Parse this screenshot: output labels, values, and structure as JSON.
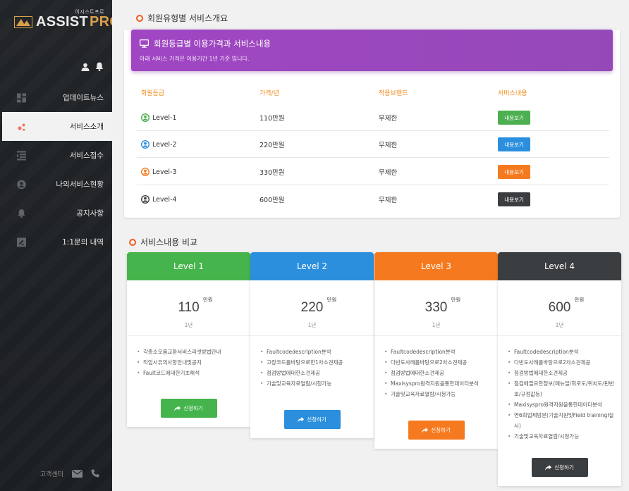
{
  "brand": {
    "small": "어시스트프로",
    "name": "ASSIST",
    "suffix": "PRO"
  },
  "sidebar": {
    "items": [
      {
        "label": "업데이트뉴스",
        "icon": "dashboard-icon"
      },
      {
        "label": "서비스소개",
        "icon": "molecule-icon",
        "active": true
      },
      {
        "label": "서비스접수",
        "icon": "list-icon"
      },
      {
        "label": "나의서비스현황",
        "icon": "user-circle-icon"
      },
      {
        "label": "공지사항",
        "icon": "bell-icon"
      },
      {
        "label": "1:1문의 내역",
        "icon": "message-icon"
      }
    ],
    "footer_label": "고객센터"
  },
  "overview": {
    "section_title": "회원유형별 서비스개요",
    "banner_title": "회원등급별 이용가격과 서비스내용",
    "banner_subtitle": "아래 서비스 가격은 이용기간 1년 기준 입니다.",
    "headers": [
      "회원등급",
      "가격/년",
      "적용브랜드",
      "서비스내용"
    ],
    "rows": [
      {
        "level": "Level-1",
        "price": "110만원",
        "brand": "무제한",
        "button": "내용보기",
        "color": "#4caf50"
      },
      {
        "level": "Level-2",
        "price": "220만원",
        "brand": "무제한",
        "button": "내용보기",
        "color": "#2b8fdd"
      },
      {
        "level": "Level-3",
        "price": "330만원",
        "brand": "무제한",
        "button": "내용보기",
        "color": "#f57a1f"
      },
      {
        "level": "Level-4",
        "price": "600만원",
        "brand": "무제한",
        "button": "내용보기",
        "color": "#3b3e41"
      }
    ]
  },
  "comparison": {
    "section_title": "서비스내용 비교",
    "plans": [
      {
        "name": "Level 1",
        "price": "110",
        "unit": "만원",
        "period": "1년",
        "color": "#45b44c",
        "button": "신청하기",
        "features": [
          "각종소모품교환서비스리셋방법안내",
          "작업시유의사항안내및공지",
          "Fault코드에대한기초해석"
        ]
      },
      {
        "name": "Level 2",
        "price": "220",
        "unit": "만원",
        "period": "1년",
        "color": "#2b8fdd",
        "button": "신청하기",
        "features": [
          "Faultcodedescription분석",
          "고장코드를바탕으로한1차소견제공",
          "점검방법에대한소견제공",
          "기술및교육자료열람/시청가능"
        ]
      },
      {
        "name": "Level 3",
        "price": "330",
        "unit": "만원",
        "period": "1년",
        "color": "#f57a1f",
        "button": "신청하기",
        "features": [
          "Faultcodedescription분석",
          "다빈도사례를바탕으로2차소견제공",
          "점검방법에대한소견제공",
          "Maxisyspro원격지원을통한데이터분석",
          "기술및교육자료열람/시청가능"
        ]
      },
      {
        "name": "Level 4",
        "price": "600",
        "unit": "만원",
        "period": "1년",
        "color": "#3b3e41",
        "button": "신청하기",
        "features": [
          "Faultcodedescription분석",
          "다빈도사례를바탕으로2차소견제공",
          "점검방법에대한소견제공",
          "점검에필요한정보(매뉴얼/회로도/위치도/핀번호/규정값등)",
          "Maxisyspro원격지원을통한데이터분석",
          "연6회업체방문(기술지원및Field trainingl실시)",
          "기술및교육자료열람/시청가능"
        ]
      }
    ]
  }
}
